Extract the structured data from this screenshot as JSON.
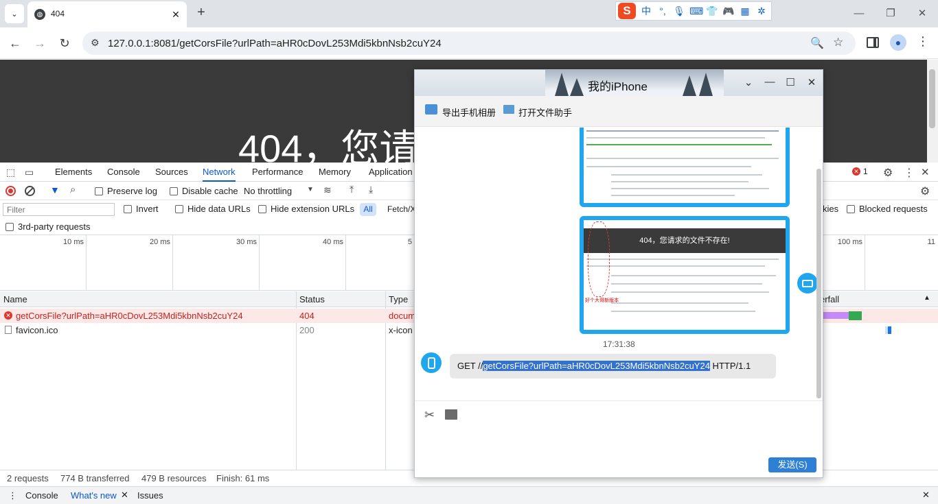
{
  "browser": {
    "tab_title": "404",
    "url": "127.0.0.1:8081/getCorsFile?urlPath=aHR0cDovL253Mdi5kbnNsb2cuY24",
    "ime": {
      "logo": "S",
      "mode": "中",
      "punct": "°,"
    }
  },
  "page": {
    "heading": "404，您请"
  },
  "devtools": {
    "tabs": [
      "Elements",
      "Console",
      "Sources",
      "Network",
      "Performance",
      "Memory",
      "Application"
    ],
    "active_tab": "Network",
    "error_count": "1",
    "toolbar": {
      "preserve_log": "Preserve log",
      "disable_cache": "Disable cache",
      "throttling": "No throttling"
    },
    "filter": {
      "placeholder": "Filter",
      "invert": "Invert",
      "hide_data_urls": "Hide data URLs",
      "hide_extension_urls": "Hide extension URLs",
      "type_all": "All",
      "type_fetch": "Fetch/X",
      "cookies_partial": "kies",
      "blocked_requests": "Blocked requests",
      "third_party": "3rd-party requests"
    },
    "overview_ticks": [
      "10 ms",
      "20 ms",
      "30 ms",
      "40 ms",
      "5",
      "100 ms",
      "11"
    ],
    "columns": {
      "name": "Name",
      "status": "Status",
      "type": "Type",
      "waterfall": "erfall"
    },
    "requests": [
      {
        "name": "getCorsFile?urlPath=aHR0cDovL253Mdi5kbnNsb2cuY24",
        "status": "404",
        "type": "docum",
        "error": true
      },
      {
        "name": "favicon.ico",
        "status": "200",
        "type": "x-icon",
        "error": false
      }
    ],
    "summary": {
      "requests": "2 requests",
      "transferred": "774 B transferred",
      "resources": "479 B resources",
      "finish": "Finish: 61 ms"
    },
    "drawer": {
      "console": "Console",
      "whats_new": "What's new",
      "issues": "Issues"
    }
  },
  "chat": {
    "title": "我的iPhone",
    "tools": {
      "export_album": "导出手机相册",
      "open_file_helper": "打开文件助手"
    },
    "screenshot2_caption": "404，您请求的文件不存在!",
    "screenshot2_annotation": "好个大哥新版本",
    "time": "17:31:38",
    "message": {
      "prefix": "GET //",
      "selected": "getCorsFile?urlPath=aHR0cDovL253Mdi5kbnNsb2cuY24",
      "suffix": " HTTP/1.1"
    },
    "send_button": "发送(S)"
  },
  "colors": {
    "accent_blue": "#0b57d0",
    "error_red": "#dc362e",
    "bubble_blue": "#1ea7ef"
  }
}
